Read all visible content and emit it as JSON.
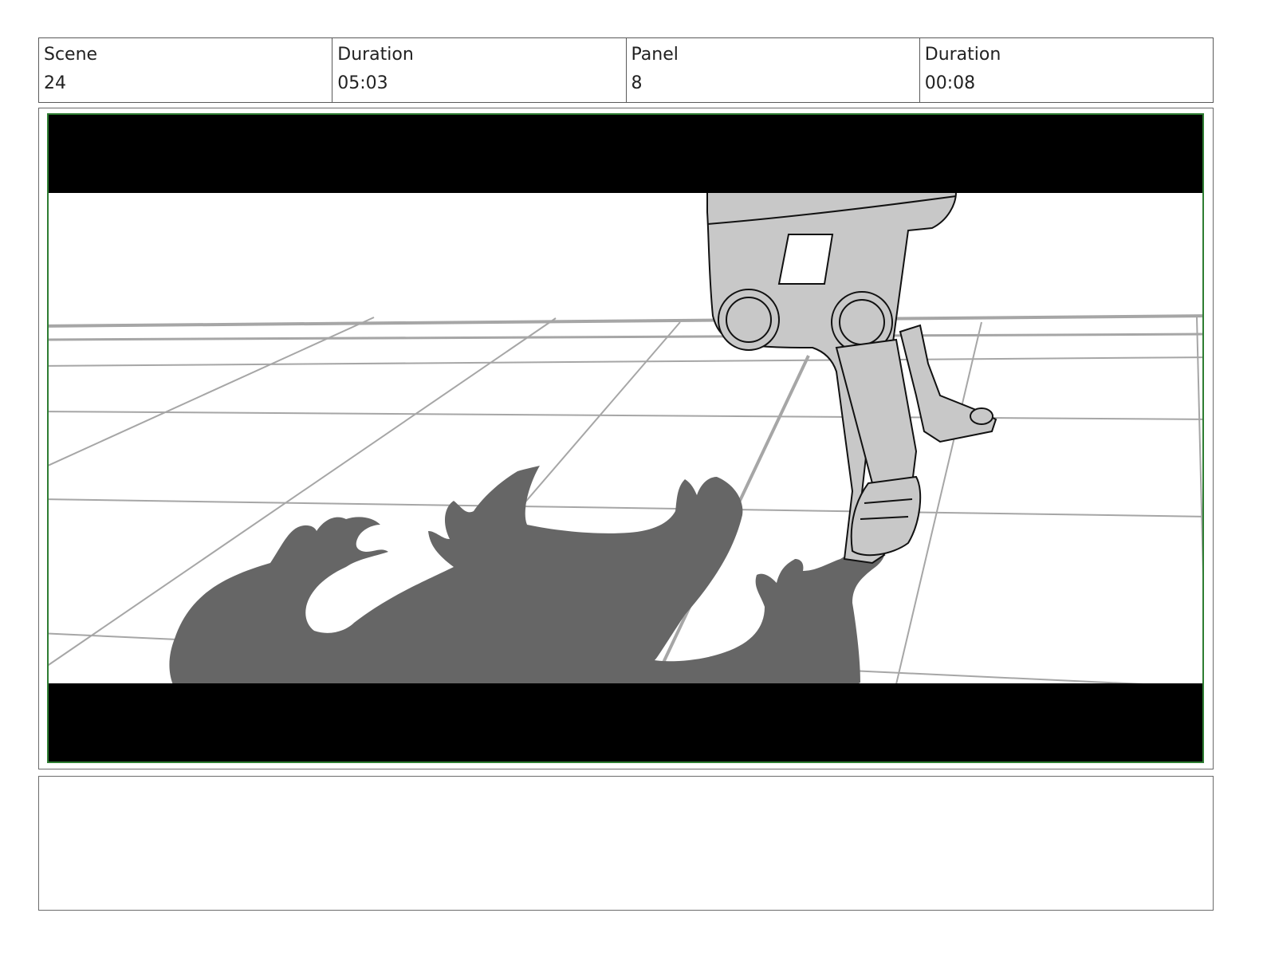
{
  "header": {
    "scene_label": "Scene",
    "scene_value": "24",
    "scene_duration_label": "Duration",
    "scene_duration_value": "05:03",
    "panel_label": "Panel",
    "panel_value": "8",
    "panel_duration_label": "Duration",
    "panel_duration_value": "00:08"
  },
  "panel_image": {
    "content": "storyboard sketch: robotic legs stepping on tiled floor beside a dark monster-shaped shadow",
    "letterbox_color": "#000000",
    "frame_border_color": "#2e7d32",
    "shadow_color": "#666666",
    "leg_fill_color": "#c8c8c8",
    "floor_line_color": "#a6a6a6"
  },
  "notes": {
    "text": ""
  }
}
